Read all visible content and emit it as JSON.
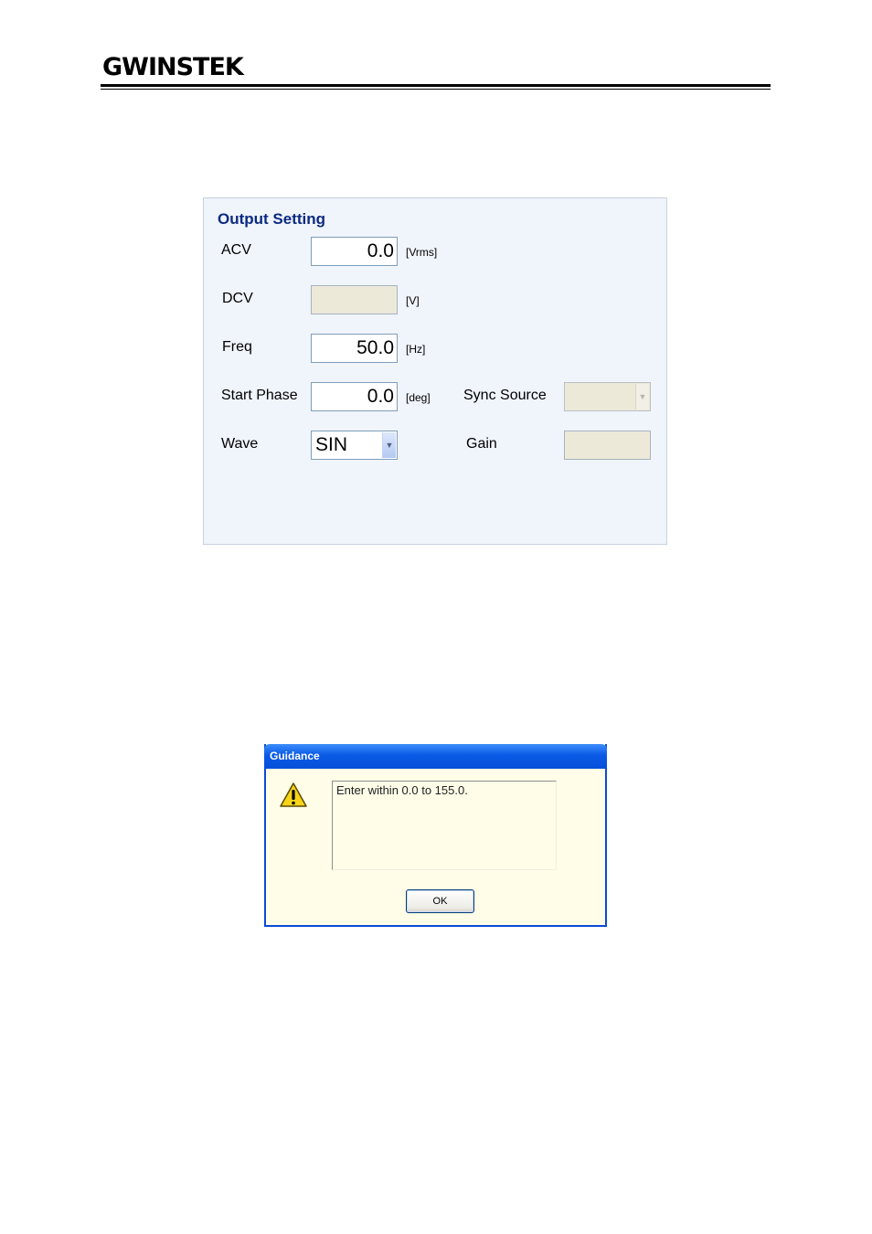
{
  "header": {
    "logo_text": "GWINSTEK"
  },
  "output_setting": {
    "title": "Output Setting",
    "acv": {
      "label": "ACV",
      "value": "0.0",
      "unit": "[Vrms]"
    },
    "dcv": {
      "label": "DCV",
      "value": "",
      "unit": "[V]"
    },
    "freq": {
      "label": "Freq",
      "value": "50.0",
      "unit": "[Hz]"
    },
    "start_phase": {
      "label": "Start Phase",
      "value": "0.0",
      "unit": "[deg]"
    },
    "sync_source": {
      "label": "Sync Source",
      "value": ""
    },
    "wave": {
      "label": "Wave",
      "value": "SIN"
    },
    "gain": {
      "label": "Gain",
      "value": ""
    }
  },
  "dialog": {
    "title": "Guidance",
    "message": "Enter within 0.0 to 155.0.",
    "ok_label": "OK",
    "icon": "warning-icon"
  },
  "colors": {
    "panel_bg": "#f0f4fb",
    "title_blue": "#0b2a82",
    "dialog_border": "#0a4bd8",
    "dialog_bg": "#fffde8"
  }
}
